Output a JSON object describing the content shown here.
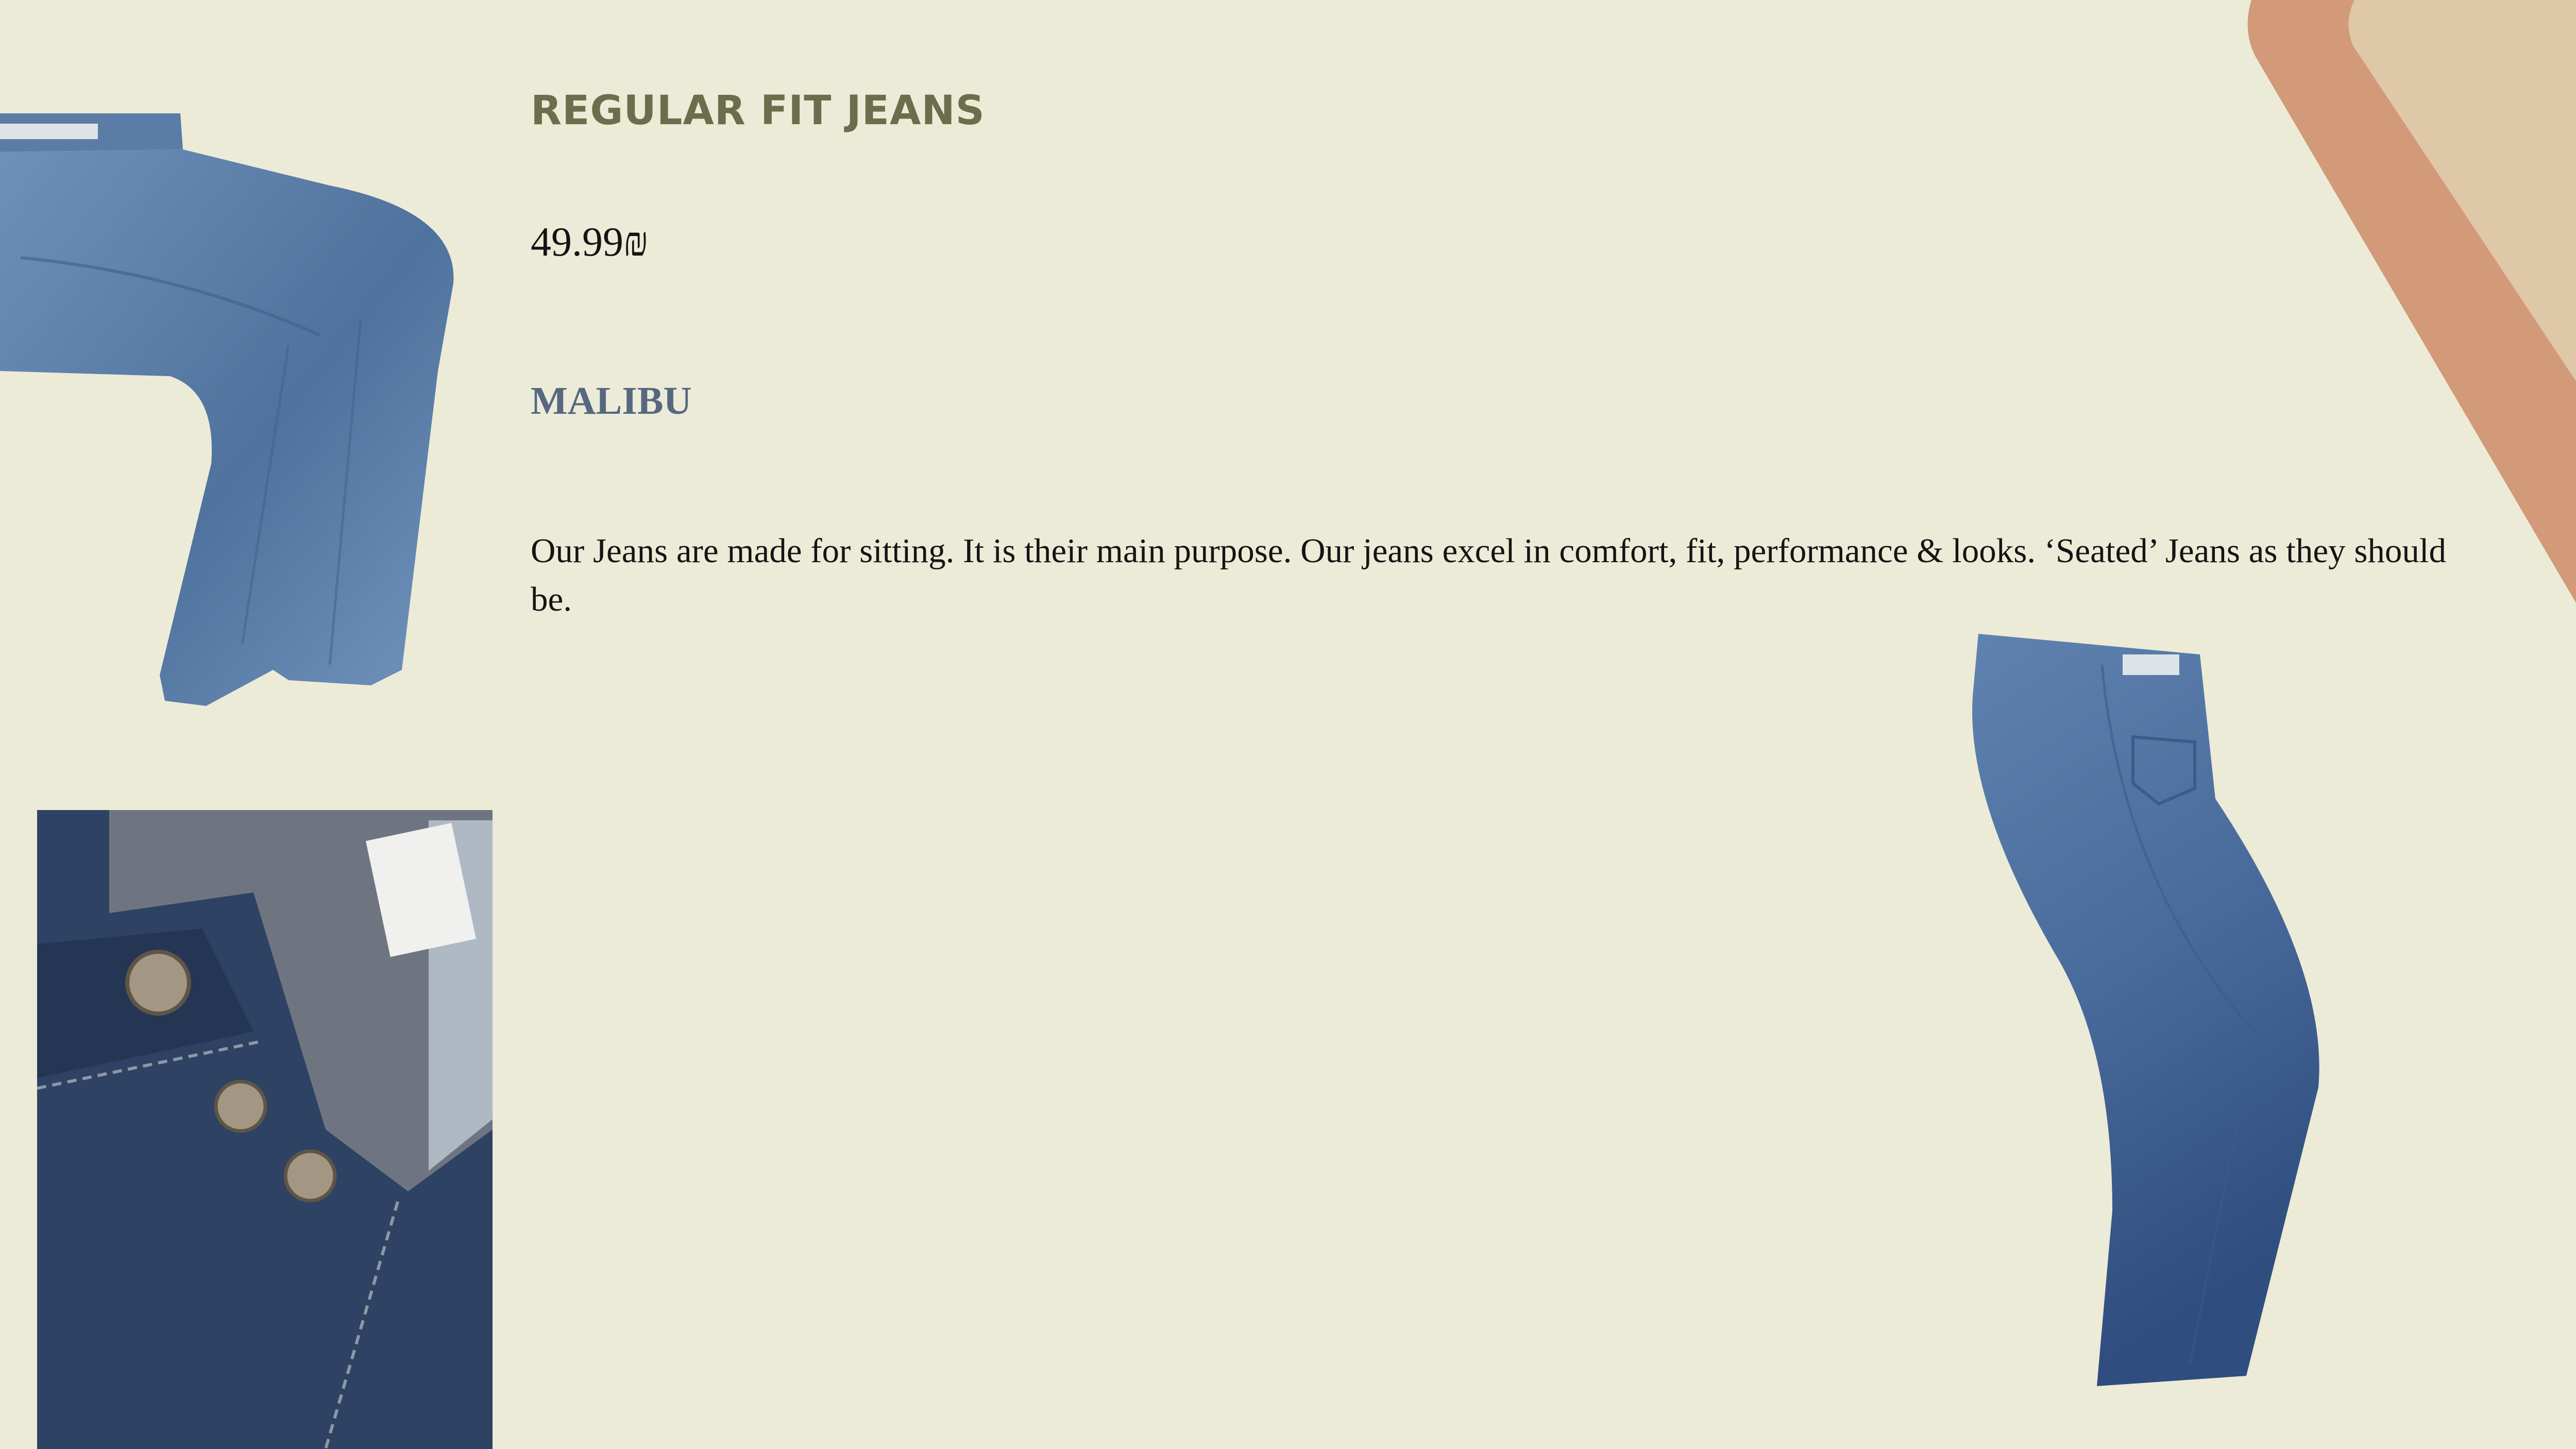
{
  "product": {
    "title": "REGULAR FIT JEANS",
    "price": "49.99₪",
    "brand": "MALIBU",
    "description": "Our Jeans are made for sitting. It is their main purpose. Our jeans excel in comfort, fit, performance & looks. ‘Seated’ Jeans as they should be."
  },
  "colors": {
    "background": "#ECEBD7",
    "title": "#6A6E4D",
    "brand": "#566780",
    "text": "#141414",
    "accent_outer": "#D29A78",
    "accent_inner": "#DEC8A8",
    "denim": "#4D6F9C"
  }
}
